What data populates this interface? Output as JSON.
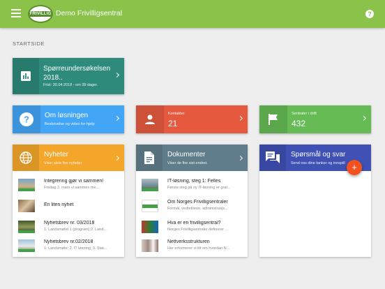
{
  "header": {
    "title": "Demo Frivilligsentral",
    "logo_text": "FRIVILLIG"
  },
  "page": {
    "label": "STARTSIDE"
  },
  "survey": {
    "title": "Spørreundersøkelsen 2018..",
    "subtitle": "Frist: 30.04.2018 - om 39 dager."
  },
  "about": {
    "title": "Om løsningen",
    "subtitle": "Beskrivelse og video for hjelp"
  },
  "contacts": {
    "label": "Kontakter",
    "count": "21"
  },
  "central": {
    "label": "Sentraler i drift",
    "count": "432"
  },
  "news": {
    "title": "Nyheter",
    "subtitle": "Viser siste fire nyheter",
    "items": [
      {
        "title": "Integrering gjør vi sammen!",
        "desc": "Fredag 2. mars vi sammen me..."
      },
      {
        "title": "En liten nyhet",
        "desc": ""
      },
      {
        "title": "Nyhetsbrev nr. 03/2018",
        "desc": "1. Landsmøtet 1 (program);2. Land..."
      },
      {
        "title": "Nyhetsbrev nr.02/2018",
        "desc": "1. Landsmøte; 2. IT løsning; 3. Stat..."
      }
    ]
  },
  "docs": {
    "title": "Dokumenter",
    "subtitle": "Viser de fire sist endret.",
    "items": [
      {
        "title": "IT-løsning, steg 1: Felles",
        "desc": "Første steg på ny IT-løsning er grat..."
      },
      {
        "title": "Om Norges Frivilligsentraler",
        "desc": "Formål, vedtektene, administrasjs..."
      },
      {
        "title": "Hva er en frivilligsentral?",
        "desc": "Norges Frivilligsentraler definerer ..."
      },
      {
        "title": "Nettverksstrukturen",
        "desc": "Her erformerer vi litt om hvordan N..."
      }
    ]
  },
  "questions": {
    "title": "Spørsmål og svar",
    "subtitle": "Send oss dine tanker og innspill",
    "fab_label": "+"
  },
  "colors": {
    "topbar": "#8bc34a",
    "survey": "#2e8b7b",
    "about": "#42a5f5",
    "contacts": "#e55a3f",
    "central": "#66bb55",
    "news": "#f4a62a",
    "docs": "#607d8b",
    "questions": "#3f51b5",
    "fab": "#f4511e"
  }
}
